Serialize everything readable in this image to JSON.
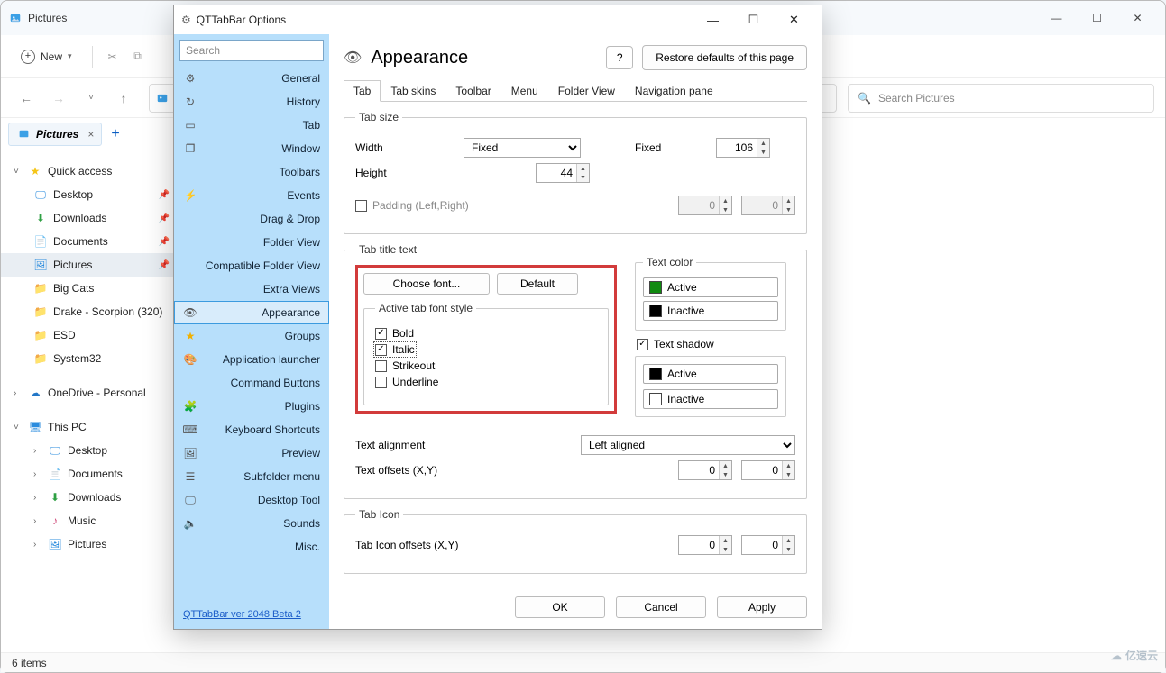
{
  "explorer": {
    "title": "Pictures",
    "new_label": "New",
    "search_placeholder": "Search Pictures",
    "tab_label": "Pictures",
    "status": "6 items",
    "tree": {
      "quick_access": "Quick access",
      "desktop": "Desktop",
      "downloads": "Downloads",
      "documents": "Documents",
      "pictures": "Pictures",
      "bigcats": "Big Cats",
      "drake": "Drake - Scorpion (320)",
      "esd": "ESD",
      "system32": "System32",
      "onedrive": "OneDrive - Personal",
      "thispc": "This PC",
      "tp_desktop": "Desktop",
      "tp_documents": "Documents",
      "tp_downloads": "Downloads",
      "tp_music": "Music",
      "tp_pictures": "Pictures"
    }
  },
  "dlg": {
    "title": "QTTabBar Options",
    "search_placeholder": "Search",
    "heading": "Appearance",
    "help_icon": "?",
    "restore": "Restore defaults of this page",
    "version_link": "QTTabBar ver 2048 Beta 2",
    "nav": {
      "general": "General",
      "history": "History",
      "tab": "Tab",
      "window": "Window",
      "toolbars": "Toolbars",
      "events": "Events",
      "dragdrop": "Drag & Drop",
      "folderview": "Folder View",
      "compat": "Compatible Folder View",
      "extra": "Extra Views",
      "appearance": "Appearance",
      "groups": "Groups",
      "launcher": "Application launcher",
      "cmdbtn": "Command Buttons",
      "plugins": "Plugins",
      "keyboard": "Keyboard Shortcuts",
      "preview": "Preview",
      "subfolder": "Subfolder menu",
      "desktoptool": "Desktop Tool",
      "sounds": "Sounds",
      "misc": "Misc."
    },
    "subtabs": {
      "tab": "Tab",
      "tabskins": "Tab skins",
      "toolbar": "Toolbar",
      "menu": "Menu",
      "folderview": "Folder View",
      "navpane": "Navigation pane"
    },
    "tabsize": {
      "legend": "Tab size",
      "width_label": "Width",
      "width_mode": "Fixed",
      "fixed_label": "Fixed",
      "fixed_value": "106",
      "height_label": "Height",
      "height_value": "44",
      "padding_label": "Padding (Left,Right)",
      "pad_l": "0",
      "pad_r": "0"
    },
    "titletext": {
      "legend": "Tab title text",
      "choose_font": "Choose font...",
      "default_btn": "Default",
      "fontstyle_legend": "Active tab font style",
      "bold": "Bold",
      "italic": "Italic",
      "strikeout": "Strikeout",
      "underline": "Underline",
      "textcolor_legend": "Text color",
      "active": "Active",
      "inactive": "Inactive",
      "shadow_label": "Text shadow",
      "align_label": "Text alignment",
      "align_value": "Left aligned",
      "offsets_label": "Text offsets (X,Y)",
      "off_x": "0",
      "off_y": "0"
    },
    "tabicon": {
      "legend": "Tab Icon",
      "offsets_label": "Tab Icon offsets (X,Y)",
      "off_x": "0",
      "off_y": "0"
    },
    "buttons": {
      "ok": "OK",
      "cancel": "Cancel",
      "apply": "Apply"
    }
  },
  "watermark": "亿速云"
}
